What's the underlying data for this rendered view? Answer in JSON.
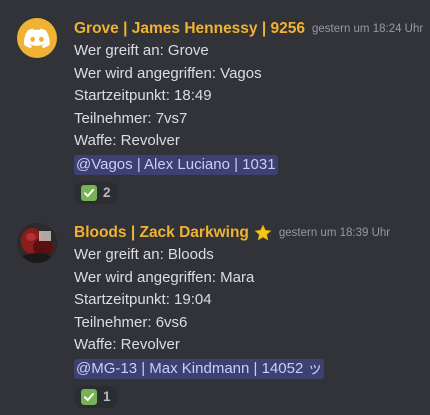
{
  "messages": [
    {
      "author": "Grove | James Hennessy | 9256",
      "author_color": "#f0b232",
      "avatar_icon": "discord-logo-icon",
      "timestamp": "gestern um 18:24 Uhr",
      "lines": [
        "Wer greift an: Grove",
        "Wer wird angegriffen: Vagos",
        "Startzeitpunkt: 18:49",
        "Teilnehmer: 7vs7",
        "Waffe: Revolver"
      ],
      "mention": "@Vagos | Alex Luciano | 1031",
      "reaction": {
        "emoji": "white-check-mark-icon",
        "count": "2"
      }
    },
    {
      "author": "Bloods | Zack Darkwing",
      "author_color": "#f0b232",
      "avatar_icon": "user-photo-avatar",
      "badge_icon": "star-icon",
      "timestamp": "gestern um 18:39 Uhr",
      "lines": [
        "Wer greift an: Bloods",
        "Wer wird angegriffen: Mara",
        "Startzeitpunkt: 19:04",
        "Teilnehmer: 6vs6",
        "Waffe: Revolver"
      ],
      "mention": "@MG-13 | Max Kindmann | 14052 ッ",
      "reaction": {
        "emoji": "white-check-mark-icon",
        "count": "1"
      }
    }
  ]
}
